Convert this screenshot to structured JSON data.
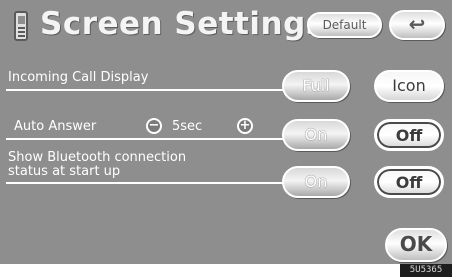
{
  "header": {
    "title": "Screen Settings",
    "default_label": "Default",
    "back_symbol": "↩"
  },
  "rows": {
    "incoming_call": {
      "label": "Incoming Call Display",
      "options": [
        "Full",
        "Icon"
      ],
      "selected": "Full"
    },
    "auto_answer": {
      "label": "Auto Answer",
      "minus": "−",
      "value": "5sec",
      "plus": "+",
      "options": [
        "On",
        "Off"
      ],
      "selected": "On"
    },
    "bluetooth_status": {
      "label_line1": "Show Bluetooth connection",
      "label_line2": "status at start up",
      "options": [
        "On",
        "Off"
      ],
      "selected": "On"
    }
  },
  "footer": {
    "ok_label": "OK",
    "image_code": "5U5365"
  },
  "colors": {
    "background": "#8e8e8e",
    "button_border": "#ffffff",
    "text": "#ffffff"
  }
}
